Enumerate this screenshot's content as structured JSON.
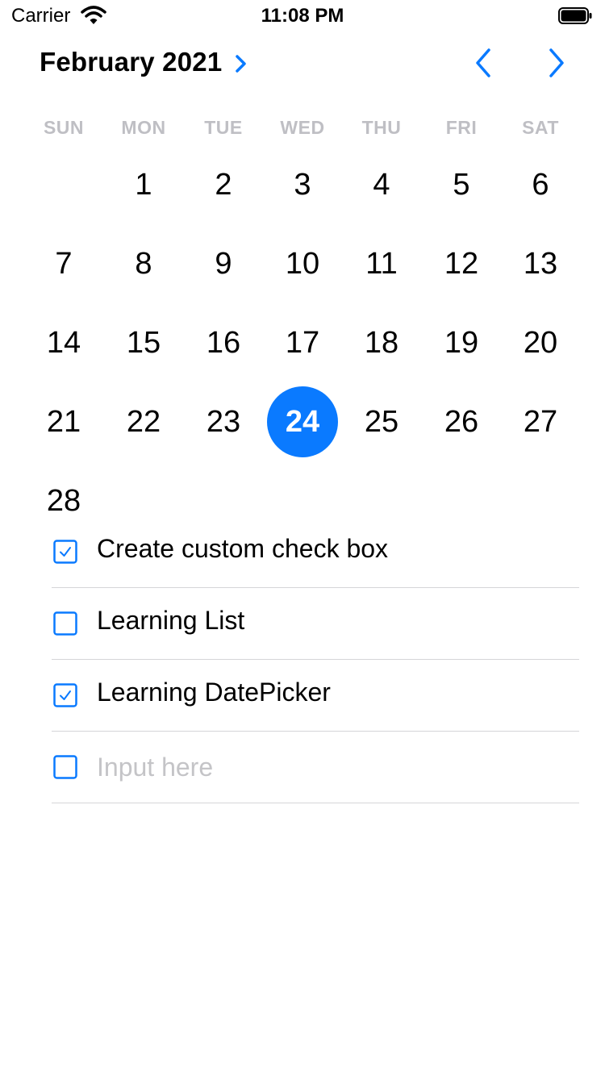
{
  "status_bar": {
    "carrier": "Carrier",
    "time": "11:08 PM"
  },
  "header": {
    "month_year": "February 2021"
  },
  "colors": {
    "accent": "#0a7aff",
    "weekday_text": "#bfbfc4",
    "separator": "#d5d5d8",
    "placeholder": "#c4c4c7"
  },
  "weekdays": [
    "SUN",
    "MON",
    "TUE",
    "WED",
    "THU",
    "FRI",
    "SAT"
  ],
  "calendar": {
    "start_weekday": 1,
    "days": [
      "1",
      "2",
      "3",
      "4",
      "5",
      "6",
      "7",
      "8",
      "9",
      "10",
      "11",
      "12",
      "13",
      "14",
      "15",
      "16",
      "17",
      "18",
      "19",
      "20",
      "21",
      "22",
      "23",
      "24",
      "25",
      "26",
      "27",
      "28"
    ],
    "selected_day": "24"
  },
  "todos": [
    {
      "label": "Create custom check box",
      "checked": true
    },
    {
      "label": "Learning List",
      "checked": false
    },
    {
      "label": "Learning DatePicker",
      "checked": true
    }
  ],
  "new_item": {
    "placeholder": "Input here",
    "value": ""
  }
}
